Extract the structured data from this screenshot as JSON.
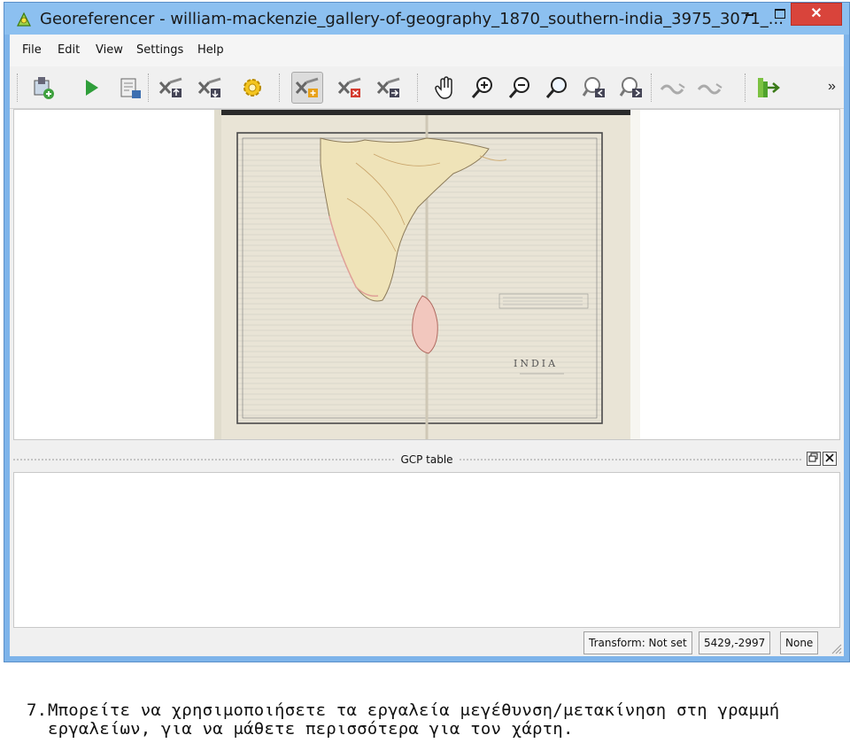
{
  "window": {
    "title": "Georeferencer - william-mackenzie_gallery-of-geography_1870_southern-india_3975_3071_...",
    "close_glyph": "✕",
    "app_icon": "qgis-georeferencer-icon"
  },
  "menubar": {
    "items": [
      "File",
      "Edit",
      "View",
      "Settings",
      "Help"
    ]
  },
  "toolbar": {
    "overflow_glyph": "»",
    "tools": [
      "open-raster-icon",
      "start-georeferencing-icon",
      "generate-gdal-script-icon",
      "load-gcp-points-icon",
      "save-gcp-points-icon",
      "transformation-settings-icon",
      "add-point-icon",
      "delete-point-icon",
      "move-gcp-point-icon",
      "pan-icon",
      "zoom-in-icon",
      "zoom-out-icon",
      "zoom-to-layer-icon",
      "zoom-last-icon",
      "zoom-next-icon",
      "link-georeferencer-to-qgis-icon",
      "link-qgis-to-georeferencer-icon",
      "full-histogram-stretch-icon"
    ]
  },
  "map": {
    "map_label": "INDIA"
  },
  "gcp_dock": {
    "title": "GCP table"
  },
  "statusbar": {
    "transform": "Transform: Not set",
    "coords": "5429,-2997",
    "crs": "None"
  },
  "caption": {
    "number": "7.",
    "line1": "Μπορείτε να χρησιμοποιήσετε τα εργαλεία μεγέθυνση/μετακίνηση στη γραμμή",
    "line2": "εργαλείων, για να μάθετε περισσότερα για τον χάρτη."
  }
}
